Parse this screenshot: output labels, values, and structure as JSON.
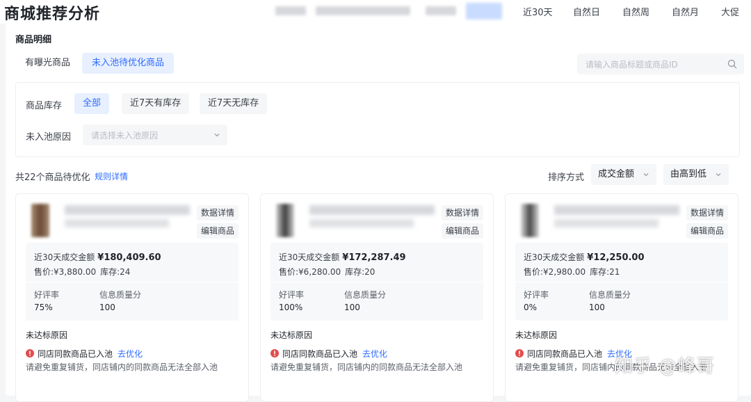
{
  "header": {
    "title": "商城推荐分析",
    "ranges": [
      "近30天",
      "自然日",
      "自然周",
      "自然月",
      "大促"
    ]
  },
  "section": {
    "title": "商品明细",
    "tabs": [
      "有曝光商品",
      "未入池待优化商品"
    ],
    "search_placeholder": "请输入商品标题或商品ID"
  },
  "filters": {
    "stock_label": "商品库存",
    "stock_options": [
      "全部",
      "近7天有库存",
      "近7天无库存"
    ],
    "reason_label": "未入池原因",
    "reason_placeholder": "请选择未入池原因"
  },
  "summary": {
    "count_text": "共22个商品待优化",
    "rule_link": "规则详情",
    "sort_label": "排序方式",
    "sort_field": "成交金额",
    "sort_order": "由高到低"
  },
  "card_labels": {
    "data_detail": "数据详情",
    "edit": "编辑商品",
    "gmv_label": "近30天成交金额",
    "rating_label": "好评率",
    "quality_label": "信息质量分",
    "reason_title": "未达标原因",
    "fix_link": "去优化"
  },
  "products": [
    {
      "gmv": "¥180,409.60",
      "price": "售价:¥3,880.00",
      "stock": "库存:24",
      "rating": "75%",
      "quality": "100",
      "reason": "同店同款商品已入池",
      "hint": "请避免重复铺货，同店铺内的同款商品无法全部入池"
    },
    {
      "gmv": "¥172,287.49",
      "price": "售价:¥6,280.00",
      "stock": "库存:20",
      "rating": "100%",
      "quality": "100",
      "reason": "同店同款商品已入池",
      "hint": "请避免重复铺货，同店铺内的同款商品无法全部入池"
    },
    {
      "gmv": "¥12,250.00",
      "price": "售价:¥2,980.00",
      "stock": "库存:21",
      "rating": "0%",
      "quality": "100",
      "reason": "同店同款商品已入池",
      "hint": "请避免重复铺货，同店铺内的同款商品无法全部入池"
    }
  ],
  "watermark": "知乎 @峰哥",
  "colors": {
    "accent": "#2f6bff",
    "warning": "#e34d4d",
    "active_bg": "#e8f0ff"
  }
}
